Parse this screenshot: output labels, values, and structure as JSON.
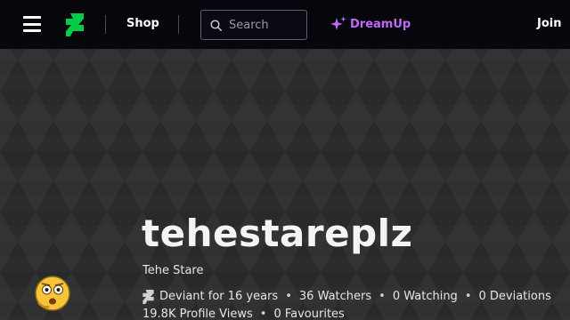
{
  "header": {
    "menu_icon": "hamburger-icon",
    "logo_icon": "deviantart-logo-icon",
    "shop_label": "Shop",
    "search": {
      "placeholder": "Search",
      "value": "",
      "icon": "search-icon"
    },
    "dreamup": {
      "label": "DreamUp",
      "icon": "sparkle-icon",
      "color": "#c069f5"
    },
    "join_label": "Join"
  },
  "profile": {
    "username": "tehestareplz",
    "tagline": "Tehe Stare",
    "avatar_icon": "shocked-emoji-avatar",
    "deviant_icon": "deviantart-mark-icon",
    "stats_row1": [
      "Deviant for 16 years",
      "36 Watchers",
      "0 Watching",
      "0 Deviations"
    ],
    "stats_row2": [
      "19.8K Profile Views",
      "0 Favourites"
    ],
    "separator": "•"
  },
  "colors": {
    "topbar_bg": "#06070d",
    "brand_green": "#05cc47",
    "background": "#2b2c2e"
  }
}
